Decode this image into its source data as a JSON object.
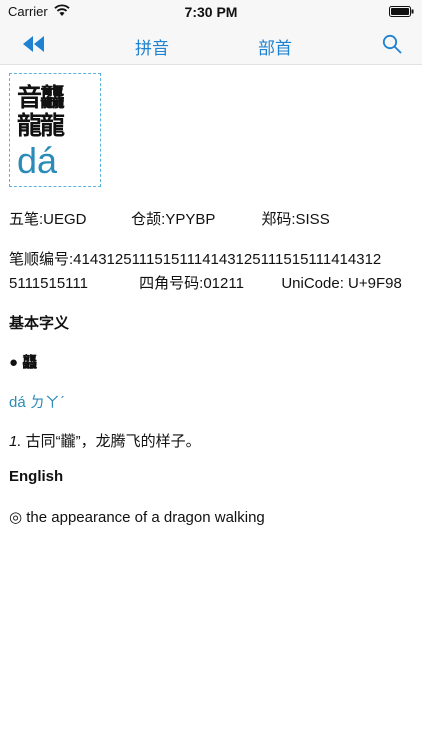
{
  "status": {
    "carrier": "Carrier",
    "time": "7:30 PM"
  },
  "nav": {
    "tab_pinyin": "拼音",
    "tab_bushou": "部首"
  },
  "char": {
    "glyph_top": "音龘",
    "glyph_bottom": "龍龍",
    "pinyin": "dá"
  },
  "codes": {
    "wubi": "五笔:UEGD",
    "cangjie": "仓颉:YPYBP",
    "zhengma": "郑码:SISS"
  },
  "stroke": {
    "line1": "笔顺编号:4143125111515111414312511151511141431​2",
    "line2": "5111515111",
    "sijiao": "四角号码:01211",
    "unicode": "UniCode: U+9F98"
  },
  "basic": {
    "heading": "基本字义",
    "entry": "● 龘",
    "pinyin": "dá ㄉㄚˊ",
    "def_num": "1.",
    "def_text": " 古同“龖”，龙腾飞的样子。"
  },
  "english": {
    "heading": "English",
    "definition": "◎ the appearance of a dragon walking"
  },
  "colors": {
    "accent": "#1e82d2",
    "pinyin": "#2b8bb8",
    "border": "#5bb3de"
  }
}
